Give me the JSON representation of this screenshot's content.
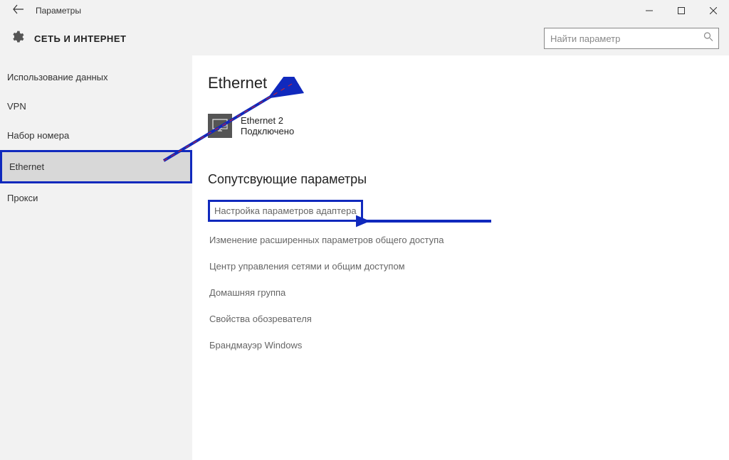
{
  "titlebar": {
    "title": "Параметры"
  },
  "header": {
    "title": "СЕТЬ И ИНТЕРНЕТ"
  },
  "search": {
    "placeholder": "Найти параметр"
  },
  "sidebar": {
    "items": [
      {
        "label": "Использование данных"
      },
      {
        "label": "VPN"
      },
      {
        "label": "Набор номера"
      },
      {
        "label": "Ethernet"
      },
      {
        "label": "Прокси"
      }
    ]
  },
  "main": {
    "page_title": "Ethernet",
    "connection": {
      "name": "Ethernet 2",
      "status": "Подключено"
    },
    "section_title": "Сопутсвующие параметры",
    "links": [
      "Настройка параметров адаптера",
      "Изменение расширенных параметров общего доступа",
      "Центр управления сетями и общим доступом",
      "Домашняя группа",
      "Свойства обозревателя",
      "Брандмауэр Windows"
    ]
  }
}
